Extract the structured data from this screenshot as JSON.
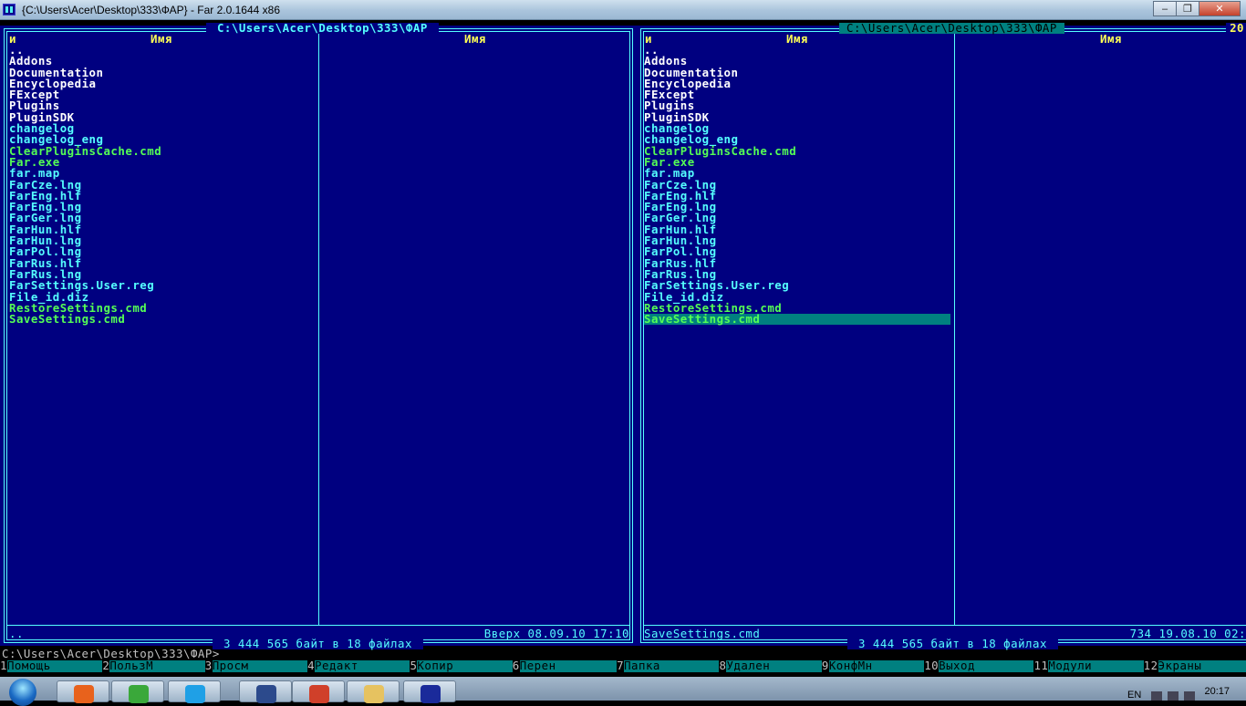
{
  "window": {
    "title": "{C:\\Users\\Acer\\Desktop\\333\\ФАР} - Far 2.0.1644 x86",
    "min_label": "–",
    "max_label": "❐",
    "close_label": "✕"
  },
  "left_panel": {
    "path": " C:\\Users\\Acer\\Desktop\\333\\ФАР ",
    "col_n": "и",
    "col_name_1": "Имя",
    "col_name_2": "Имя",
    "files": [
      {
        "name": "..",
        "kind": "dir"
      },
      {
        "name": "Addons",
        "kind": "dir"
      },
      {
        "name": "Documentation",
        "kind": "dir"
      },
      {
        "name": "Encyclopedia",
        "kind": "dir"
      },
      {
        "name": "FExcept",
        "kind": "dir"
      },
      {
        "name": "Plugins",
        "kind": "dir"
      },
      {
        "name": "PluginSDK",
        "kind": "dir"
      },
      {
        "name": "changelog",
        "kind": "file"
      },
      {
        "name": "changelog_eng",
        "kind": "file"
      },
      {
        "name": "ClearPluginsCache.cmd",
        "kind": "exec"
      },
      {
        "name": "Far.exe",
        "kind": "exec"
      },
      {
        "name": "far.map",
        "kind": "file"
      },
      {
        "name": "FarCze.lng",
        "kind": "file"
      },
      {
        "name": "FarEng.hlf",
        "kind": "file"
      },
      {
        "name": "FarEng.lng",
        "kind": "file"
      },
      {
        "name": "FarGer.lng",
        "kind": "file"
      },
      {
        "name": "FarHun.hlf",
        "kind": "file"
      },
      {
        "name": "FarHun.lng",
        "kind": "file"
      },
      {
        "name": "FarPol.lng",
        "kind": "file"
      },
      {
        "name": "FarRus.hlf",
        "kind": "file"
      },
      {
        "name": "FarRus.lng",
        "kind": "file"
      },
      {
        "name": "FarSettings.User.reg",
        "kind": "file"
      },
      {
        "name": "File_id.diz",
        "kind": "file"
      },
      {
        "name": "RestoreSettings.cmd",
        "kind": "exec"
      },
      {
        "name": "SaveSettings.cmd",
        "kind": "exec"
      }
    ],
    "status_name": "..",
    "status_info": "Вверх 08.09.10 17:10",
    "summary": " 3 444 565 байт в 18 файлах "
  },
  "right_panel": {
    "path": "C:\\Users\\Acer\\Desktop\\333\\ФАР",
    "clock_fragment": "20",
    "col_n": "и",
    "col_name_1": "Имя",
    "col_name_2": "Имя",
    "files": [
      {
        "name": "..",
        "kind": "dir"
      },
      {
        "name": "Addons",
        "kind": "dir"
      },
      {
        "name": "Documentation",
        "kind": "dir"
      },
      {
        "name": "Encyclopedia",
        "kind": "dir"
      },
      {
        "name": "FExcept",
        "kind": "dir"
      },
      {
        "name": "Plugins",
        "kind": "dir"
      },
      {
        "name": "PluginSDK",
        "kind": "dir"
      },
      {
        "name": "changelog",
        "kind": "file"
      },
      {
        "name": "changelog_eng",
        "kind": "file"
      },
      {
        "name": "ClearPluginsCache.cmd",
        "kind": "exec"
      },
      {
        "name": "Far.exe",
        "kind": "exec"
      },
      {
        "name": "far.map",
        "kind": "file"
      },
      {
        "name": "FarCze.lng",
        "kind": "file"
      },
      {
        "name": "FarEng.hlf",
        "kind": "file"
      },
      {
        "name": "FarEng.lng",
        "kind": "file"
      },
      {
        "name": "FarGer.lng",
        "kind": "file"
      },
      {
        "name": "FarHun.hlf",
        "kind": "file"
      },
      {
        "name": "FarHun.lng",
        "kind": "file"
      },
      {
        "name": "FarPol.lng",
        "kind": "file"
      },
      {
        "name": "FarRus.hlf",
        "kind": "file"
      },
      {
        "name": "FarRus.lng",
        "kind": "file"
      },
      {
        "name": "FarSettings.User.reg",
        "kind": "file"
      },
      {
        "name": "File_id.diz",
        "kind": "file"
      },
      {
        "name": "RestoreSettings.cmd",
        "kind": "exec"
      },
      {
        "name": "SaveSettings.cmd",
        "kind": "exec",
        "selected": true
      }
    ],
    "status_name": "SaveSettings.cmd",
    "status_info": "734 19.08.10 02:",
    "summary": " 3 444 565 байт в 18 файлах "
  },
  "command_line": "C:\\Users\\Acer\\Desktop\\333\\ФАР>",
  "keybar": [
    {
      "num": "1",
      "label": "Помощь"
    },
    {
      "num": "2",
      "label": "ПользМ"
    },
    {
      "num": "3",
      "label": "Просм"
    },
    {
      "num": "4",
      "label": "Редакт"
    },
    {
      "num": "5",
      "label": "Копир"
    },
    {
      "num": "6",
      "label": "Перен"
    },
    {
      "num": "7",
      "label": "Папка"
    },
    {
      "num": "8",
      "label": "Удален"
    },
    {
      "num": "9",
      "label": "КонфМн"
    },
    {
      "num": "10",
      "label": "Выход"
    },
    {
      "num": "11",
      "label": "Модули"
    },
    {
      "num": "12",
      "label": "Экраны"
    }
  ],
  "taskbar": {
    "apps": [
      {
        "name": "firefox-icon",
        "color": "#e8621c"
      },
      {
        "name": "utorrent-icon",
        "color": "#3aa83a"
      },
      {
        "name": "skype-icon",
        "color": "#1fa0e6"
      },
      {
        "name": "floppy-icon",
        "color": "#2c4a8c"
      },
      {
        "name": "opera-icon",
        "color": "#d0402a"
      },
      {
        "name": "explorer-folder-icon",
        "color": "#e6c260"
      },
      {
        "name": "far-icon",
        "color": "#1a2a9a"
      }
    ],
    "lang": "EN",
    "clock": "20:17"
  },
  "colors": {
    "panel_bg": "#000080",
    "frame": "#55ffff",
    "dir_text": "#ffffff",
    "file_text": "#55ffff",
    "exec_text": "#55ff55",
    "header": "#ffff55",
    "selection": "#008080"
  }
}
